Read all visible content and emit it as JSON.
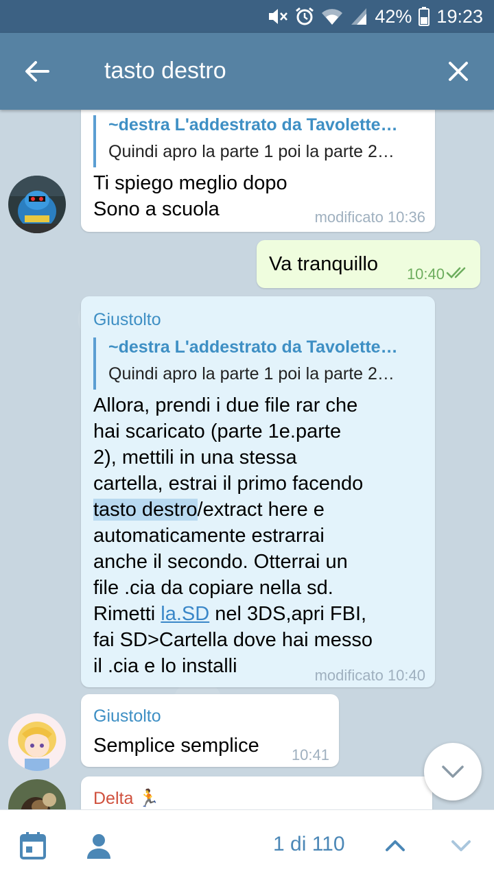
{
  "status_bar": {
    "battery": "42%",
    "time": "19:23"
  },
  "header": {
    "search_query": "tasto destro"
  },
  "messages": [
    {
      "reply_to": {
        "name": "~destra L'addestrato da Tavolette…",
        "text": "Quindi apro la parte 1 poi la parte 2…"
      },
      "lines": [
        "Ti spiego meglio dopo",
        "Sono a scuola"
      ],
      "time": "modificato 10:36"
    },
    {
      "text": "Va tranquillo",
      "time": "10:40"
    },
    {
      "sender": "Giustolto",
      "reply_to": {
        "name": "~destra L'addestrato da Tavolette…",
        "text": "Quindi apro la parte 1 poi la parte 2…"
      },
      "lines": [
        "Allora, prendi i due file rar che",
        "hai scaricato (parte 1e.parte",
        "2), mettili in una stessa",
        "cartella, estrai il primo facendo",
        {
          "highlight": "tasto destro",
          "rest": "/extract here e"
        },
        "automaticamente estrarrai",
        "anche il secondo. Otterrai un",
        "file .cia da copiare nella sd.",
        {
          "prefix": "Rimetti ",
          "link": "la.SD",
          "rest": " nel 3DS,apri FBI,"
        },
        "fai SD>Cartella dove hai messo",
        "il .cia e lo installi"
      ],
      "time": "modificato 10:40"
    },
    {
      "sender": "Giustolto",
      "text": "Semplice semplice",
      "time": "10:41"
    },
    {
      "sender": "Delta 🏃"
    }
  ],
  "search_nav": {
    "counter": "1 di 110"
  },
  "colors": {
    "header": "#5682a3",
    "status_bar": "#3c6183",
    "accent": "#3e8fc4",
    "outgoing_bubble": "#effdde",
    "highlight_bubble": "#e3f3fb"
  }
}
